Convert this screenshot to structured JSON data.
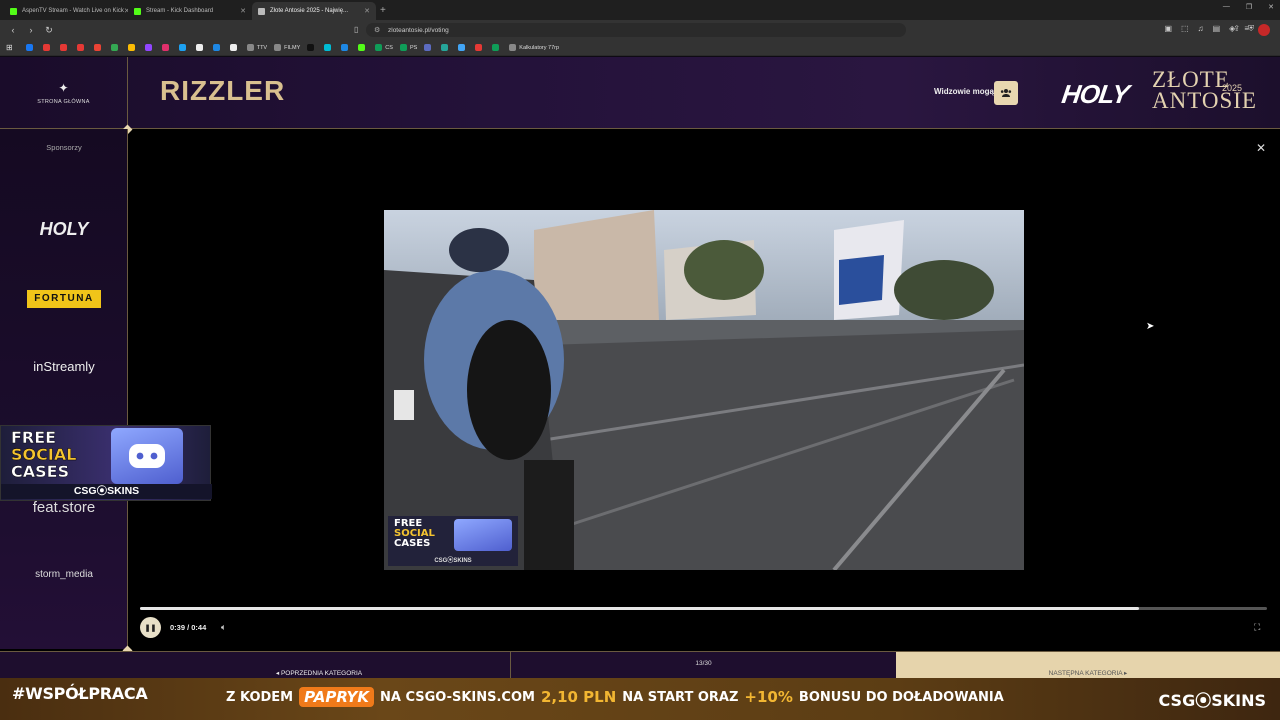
{
  "browser": {
    "tabs": [
      {
        "title": "AspenTV Stream - Watch Live on Kick",
        "color": "#53fc18",
        "active": false
      },
      {
        "title": "Stream - Kick Dashboard",
        "color": "#53fc18",
        "active": false
      },
      {
        "title": "Złote Antosie 2025 - Najwię...",
        "color": "#bbbbbb",
        "active": true
      }
    ],
    "new_tab": "+",
    "url": "zloteantosie.pl/voting",
    "bookmarks": [
      {
        "label": "",
        "color": "#1877f2"
      },
      {
        "label": "",
        "color": "#e53935"
      },
      {
        "label": "",
        "color": "#e53935"
      },
      {
        "label": "",
        "color": "#e53935"
      },
      {
        "label": "",
        "color": "#ea4335"
      },
      {
        "label": "",
        "color": "#34a853"
      },
      {
        "label": "",
        "color": "#fbbc04"
      },
      {
        "label": "",
        "color": "#9146ff"
      },
      {
        "label": "",
        "color": "#e1306c"
      },
      {
        "label": "",
        "color": "#1da1f2"
      },
      {
        "label": "",
        "color": "#eeeeee"
      },
      {
        "label": "",
        "color": "#1e88e5"
      },
      {
        "label": "",
        "color": "#eeeeee"
      },
      {
        "label": "TTV",
        "color": "#888888"
      },
      {
        "label": "FILMY",
        "color": "#888888"
      },
      {
        "label": "",
        "color": "#111111"
      },
      {
        "label": "",
        "color": "#00bcd4"
      },
      {
        "label": "",
        "color": "#1e88e5"
      },
      {
        "label": "",
        "color": "#53fc18"
      },
      {
        "label": "CS",
        "color": "#0f9d58"
      },
      {
        "label": "PS",
        "color": "#0f9d58"
      },
      {
        "label": "",
        "color": "#5c6bc0"
      },
      {
        "label": "",
        "color": "#26a69a"
      },
      {
        "label": "",
        "color": "#42a5f5"
      },
      {
        "label": "",
        "color": "#e53935"
      },
      {
        "label": "",
        "color": "#0f9d58"
      },
      {
        "label": "Kalkulatory 77rp",
        "color": "#888888"
      }
    ]
  },
  "header": {
    "home_label": "STRONA GŁÓWNA",
    "category": "RIZZLER",
    "viewers_label": "Widzowie mogą",
    "logo_holy": "HOLY",
    "logo_line1": "ZŁOTE",
    "logo_line2": "ANTOSIE",
    "logo_year": "2025"
  },
  "sidebar": {
    "title": "Sponsorzy",
    "sponsors": [
      "HOLY",
      "FORTUNA",
      "inStreamly",
      "feat.store",
      "storm_media"
    ]
  },
  "player": {
    "time": "0:39 / 0:44",
    "progress": 0.886
  },
  "bottom_nav": {
    "prev": "POPRZEDNIA KATEGORIA",
    "counter": "13/30",
    "next": "NASTĘPNA KATEGORIA"
  },
  "promo": {
    "line1": "FREE",
    "line2": "SOCIAL",
    "line3": "CASES",
    "brand": "CSG⦿SKINS"
  },
  "video_promo": {
    "line1": "FREE",
    "line2": "SOCIAL",
    "line3": "CASES",
    "brand": "CSG⦿SKINS"
  },
  "ticker": {
    "hashtag": "#WSPÓŁPRACA",
    "part1": "Z KODEM",
    "code": "PAPRYK",
    "part2": "NA CSGO-SKINS.COM",
    "amount": "2,10 PLN",
    "part3": "NA START ORAZ",
    "bonus": "+10%",
    "part4": "BONUSU DO DOŁADOWANIA",
    "brand": "CSG⦿SKINS"
  }
}
